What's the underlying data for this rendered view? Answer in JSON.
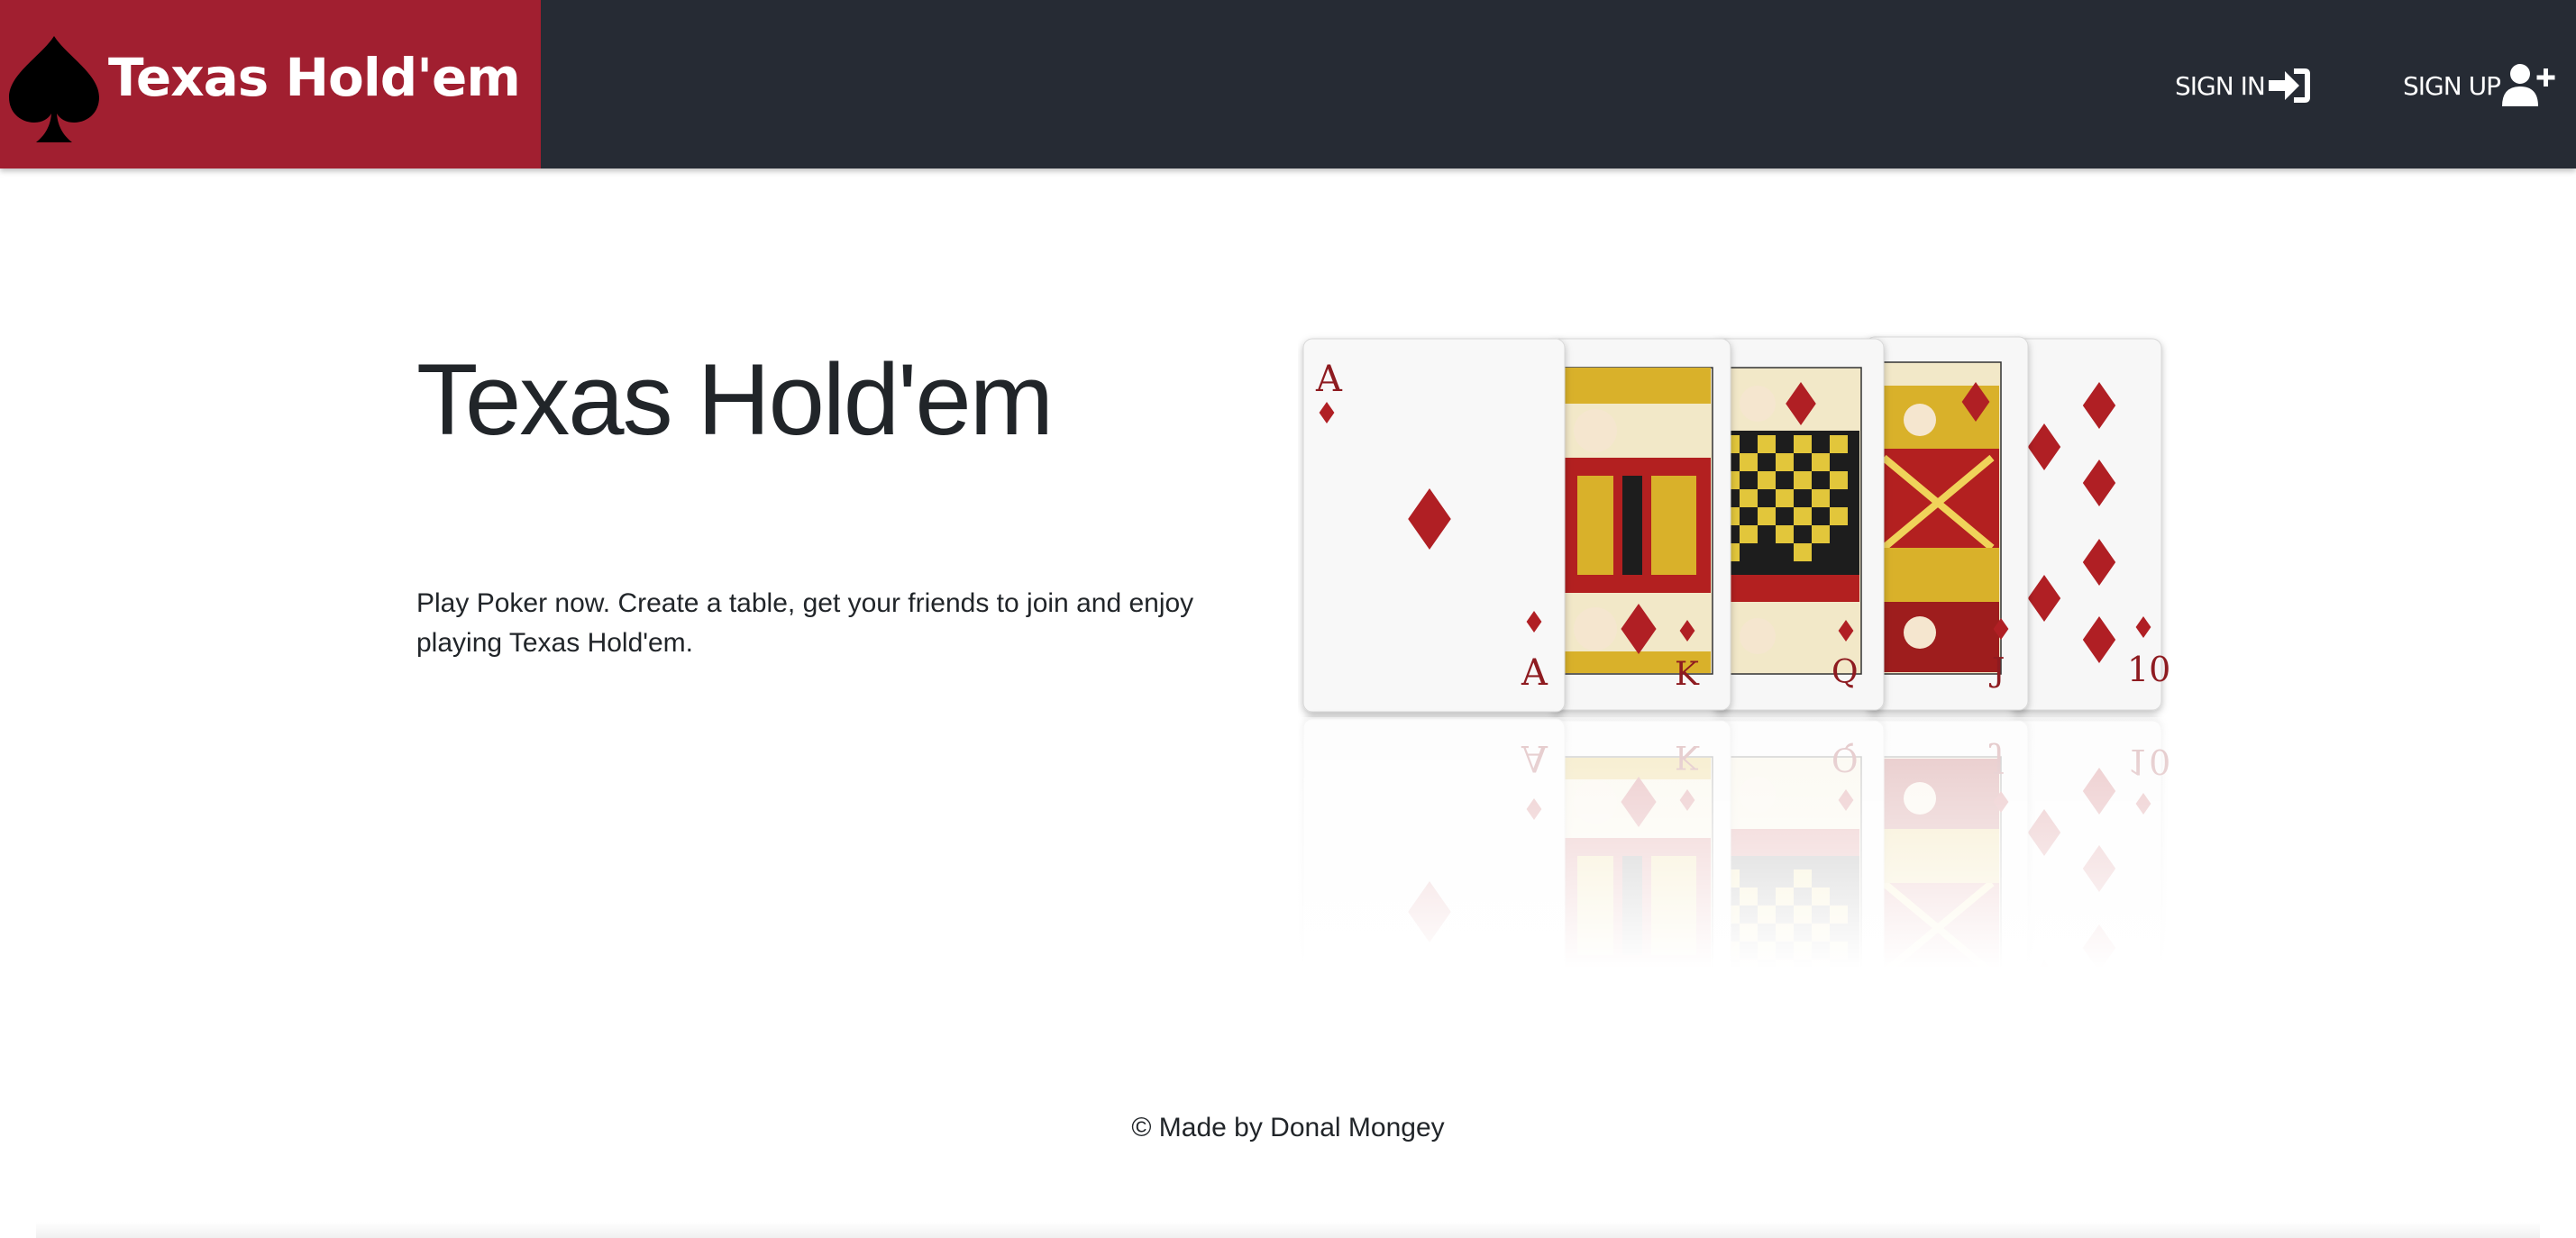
{
  "navbar": {
    "brand_title": "Texas Hold'em",
    "brand_icon": "spade-icon",
    "links": [
      {
        "label": "SIGN IN",
        "icon": "sign-in-icon"
      },
      {
        "label": "SIGN UP",
        "icon": "user-plus-icon"
      }
    ],
    "colors": {
      "background": "#262b34",
      "brand": "#a11f30"
    }
  },
  "hero": {
    "title": "Texas Hold'em",
    "description": "Play Poker now. Create a table, get your friends to join and enjoy playing Texas Hold'em.",
    "image": {
      "cards": [
        {
          "rank": "A",
          "suit": "diamonds"
        },
        {
          "rank": "K",
          "suit": "diamonds"
        },
        {
          "rank": "Q",
          "suit": "diamonds"
        },
        {
          "rank": "J",
          "suit": "diamonds"
        },
        {
          "rank": "10",
          "suit": "diamonds"
        }
      ]
    }
  },
  "footer": {
    "text": "© Made by Donal Mongey"
  }
}
